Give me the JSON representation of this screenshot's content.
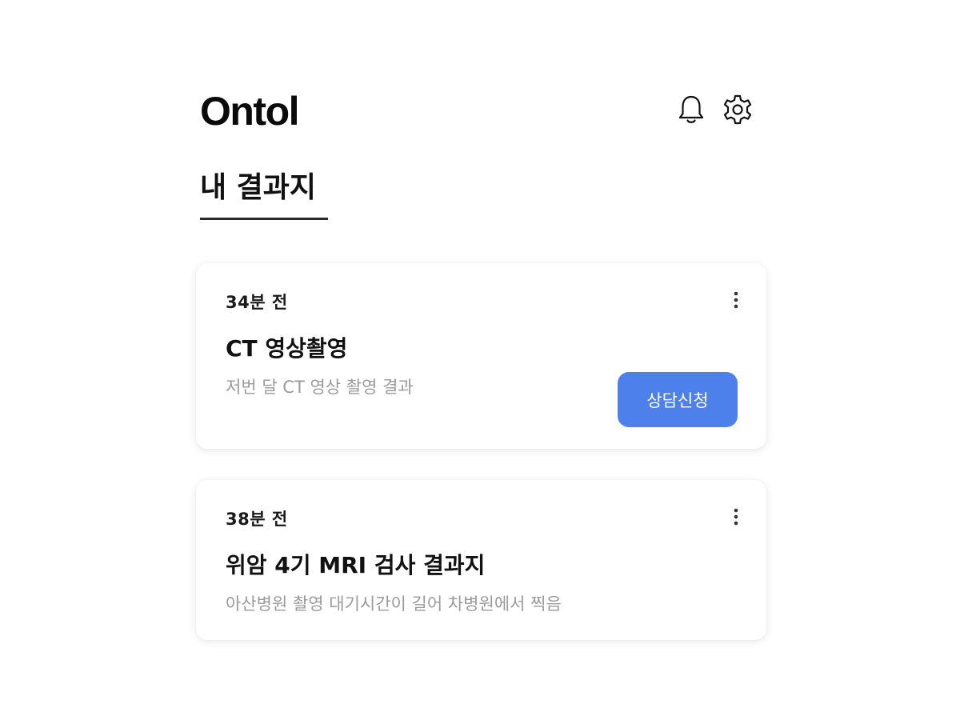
{
  "app": {
    "logo": "Ontol"
  },
  "header": {
    "icons": [
      "bell-icon",
      "gear-icon"
    ]
  },
  "page": {
    "title": "내 결과지"
  },
  "results": [
    {
      "time": "34분 전",
      "title": "CT 영상촬영",
      "description": "저번 달 CT 영상 촬영 결과",
      "action_label": "상담신청"
    },
    {
      "time": "38분 전",
      "title": "위암 4기 MRI 검사 결과지",
      "description": "아산병원 촬영 대기시간이 길어 차병원에서 찍음"
    }
  ],
  "colors": {
    "accent": "#4d80ea",
    "muted_text": "#9a9a9a"
  }
}
